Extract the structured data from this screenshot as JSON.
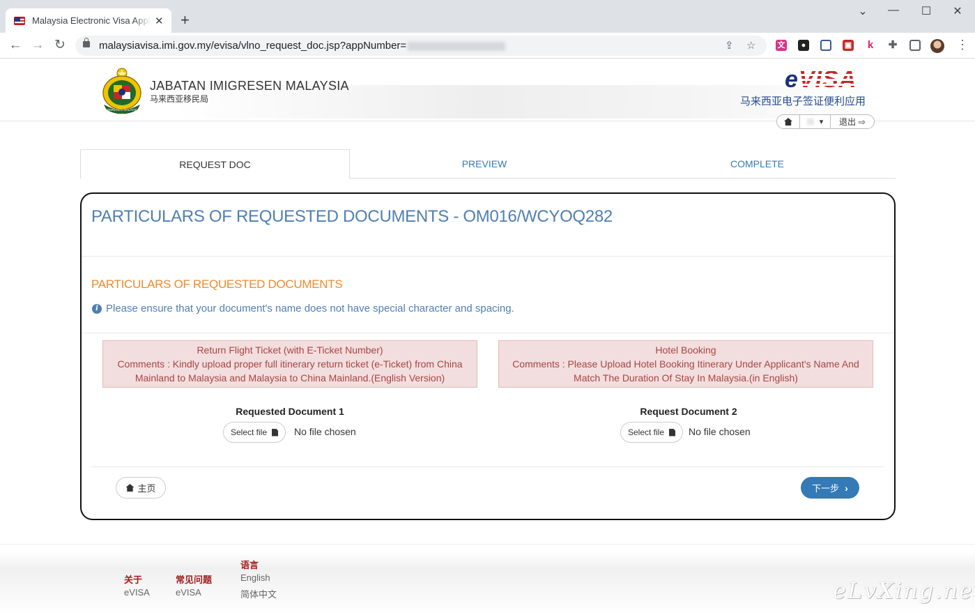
{
  "browser": {
    "tab_title": "Malaysia Electronic Visa Application",
    "url_text": "malaysiavisa.imi.gov.my/evisa/vlno_request_doc.jsp?appNumber="
  },
  "header": {
    "agency_name": "JABATAN IMIGRESEN MALAYSIA",
    "agency_name_cn": "马来西亚移民局",
    "evisa_e": "e",
    "evisa_visa": "VISA",
    "evisa_subtitle": "马来西亚电子签证便利应用",
    "logout_label": "退出"
  },
  "steps": {
    "request_doc": "REQUEST DOC",
    "preview": "PREVIEW",
    "complete": "COMPLETE"
  },
  "main": {
    "title": "PARTICULARS OF REQUESTED DOCUMENTS - OM016/WCYOQ282",
    "section_title": "PARTICULARS OF REQUESTED DOCUMENTS",
    "notice": "Please ensure that your document's name does not have special character and spacing.",
    "documents": [
      {
        "alert_title": "Return Flight Ticket (with E-Ticket Number)",
        "alert_comment": "Comments : Kindly upload proper full itinerary return ticket (e-Ticket) from China Mainland to Malaysia and Malaysia to China Mainland.(English Version)",
        "label": "Requested Document 1",
        "select_label": "Select file",
        "status": "No file chosen"
      },
      {
        "alert_title": "Hotel Booking",
        "alert_comment": "Comments : Please Upload Hotel Booking Itinerary Under Applicant's Name And Match The Duration Of Stay In Malaysia.(in English)",
        "label": "Request Document 2",
        "select_label": "Select file",
        "status": "No file chosen"
      }
    ],
    "home_button": "主页",
    "next_button": "下一步"
  },
  "footer": {
    "about_head": "关于",
    "about_link": "eVISA",
    "faq_head": "常见问题",
    "faq_link": "eVISA",
    "lang_head": "语言",
    "lang_en": "English",
    "lang_cn": "简体中文"
  },
  "watermark": "eLvXing.net",
  "colors": {
    "accent_blue": "#337ab7",
    "title_blue": "#4f7fb2",
    "section_orange": "#f0892b",
    "alert_bg": "#f2dede",
    "alert_text": "#a94442",
    "footer_red": "#a31c1c"
  }
}
